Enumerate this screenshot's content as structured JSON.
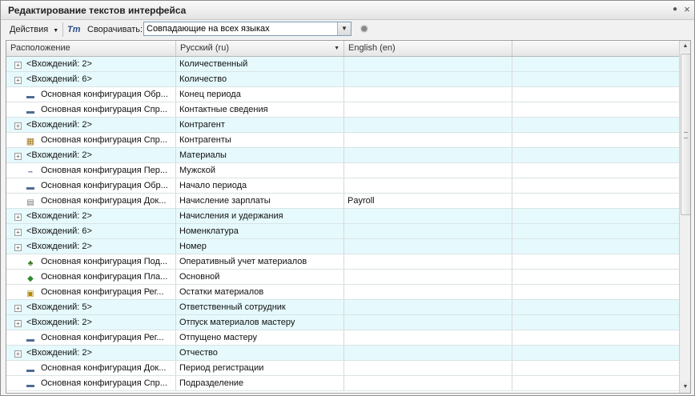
{
  "window": {
    "title": "Редактирование текстов интерфейса",
    "close_glyph": "×",
    "pin_glyph": "●"
  },
  "toolbar": {
    "actions_label": "Действия",
    "collapse_label": "Сворачивать:",
    "collapse_value": "Совпадающие на всех языках",
    "spell_icon": "Тт"
  },
  "table": {
    "columns": [
      "Расположение",
      "Русский (ru)",
      "English (en)",
      ""
    ],
    "rows": [
      {
        "kind": "group",
        "location": "<Вхождений: 2>",
        "ru": "Количественный",
        "en": "",
        "alt": true
      },
      {
        "kind": "group",
        "location": "<Вхождений: 6>",
        "ru": "Количество",
        "en": "",
        "alt": true
      },
      {
        "kind": "item",
        "icon": "dash",
        "location": "Основная конфигурация Обр...",
        "ru": "Конец периода",
        "en": "",
        "alt": false
      },
      {
        "kind": "item",
        "icon": "dash",
        "location": "Основная конфигурация Спр...",
        "ru": "Контактные сведения",
        "en": "",
        "alt": false
      },
      {
        "kind": "group",
        "location": "<Вхождений: 2>",
        "ru": "Контрагент",
        "en": "",
        "alt": true
      },
      {
        "kind": "item",
        "icon": "table",
        "location": "Основная конфигурация Спр...",
        "ru": "Контрагенты",
        "en": "",
        "alt": false
      },
      {
        "kind": "group",
        "location": "<Вхождений: 2>",
        "ru": "Материалы",
        "en": "",
        "alt": true
      },
      {
        "kind": "item",
        "icon": "dotted",
        "location": "Основная конфигурация Пер...",
        "ru": "Мужской",
        "en": "",
        "alt": false
      },
      {
        "kind": "item",
        "icon": "dash",
        "location": "Основная конфигурация Обр...",
        "ru": "Начало периода",
        "en": "",
        "alt": false
      },
      {
        "kind": "item",
        "icon": "doc",
        "location": "Основная конфигурация Док...",
        "ru": "Начисление зарплаты",
        "en": "Payroll",
        "alt": false
      },
      {
        "kind": "group",
        "location": "<Вхождений: 2>",
        "ru": "Начисления и удержания",
        "en": "",
        "alt": true
      },
      {
        "kind": "group",
        "location": "<Вхождений: 6>",
        "ru": "Номенклатура",
        "en": "",
        "alt": true
      },
      {
        "kind": "group",
        "location": "<Вхождений: 2>",
        "ru": "Номер",
        "en": "",
        "alt": true
      },
      {
        "kind": "item",
        "icon": "org",
        "location": "Основная конфигурация Под...",
        "ru": "Оперативный учет материалов",
        "en": "",
        "alt": false
      },
      {
        "kind": "item",
        "icon": "layers",
        "location": "Основная конфигурация Пла...",
        "ru": "Основной",
        "en": "",
        "alt": false
      },
      {
        "kind": "item",
        "icon": "note",
        "location": "Основная конфигурация Рег...",
        "ru": "Остатки материалов",
        "en": "",
        "alt": false
      },
      {
        "kind": "group",
        "location": "<Вхождений: 5>",
        "ru": "Ответственный сотрудник",
        "en": "",
        "alt": true
      },
      {
        "kind": "group",
        "location": "<Вхождений: 2>",
        "ru": "Отпуск материалов мастеру",
        "en": "",
        "alt": true
      },
      {
        "kind": "item",
        "icon": "dash",
        "location": "Основная конфигурация Рег...",
        "ru": "Отпущено мастеру",
        "en": "",
        "alt": false
      },
      {
        "kind": "group",
        "location": "<Вхождений: 2>",
        "ru": "Отчество",
        "en": "",
        "alt": true
      },
      {
        "kind": "item",
        "icon": "dash",
        "location": "Основная конфигурация Док...",
        "ru": "Период регистрации",
        "en": "",
        "alt": false
      },
      {
        "kind": "item",
        "icon": "dash",
        "location": "Основная конфигурация Спр...",
        "ru": "Подразделение",
        "en": "",
        "alt": false
      }
    ]
  },
  "icons": {
    "expander": "+",
    "dash": "▬",
    "dotted": "┅",
    "table": "▦",
    "doc": "▤",
    "org": "♣",
    "layers": "◆",
    "note": "▣",
    "gear": "✹",
    "dropdown": "▼",
    "scroll_up": "▲",
    "scroll_down": "▼",
    "sort": "▼"
  }
}
